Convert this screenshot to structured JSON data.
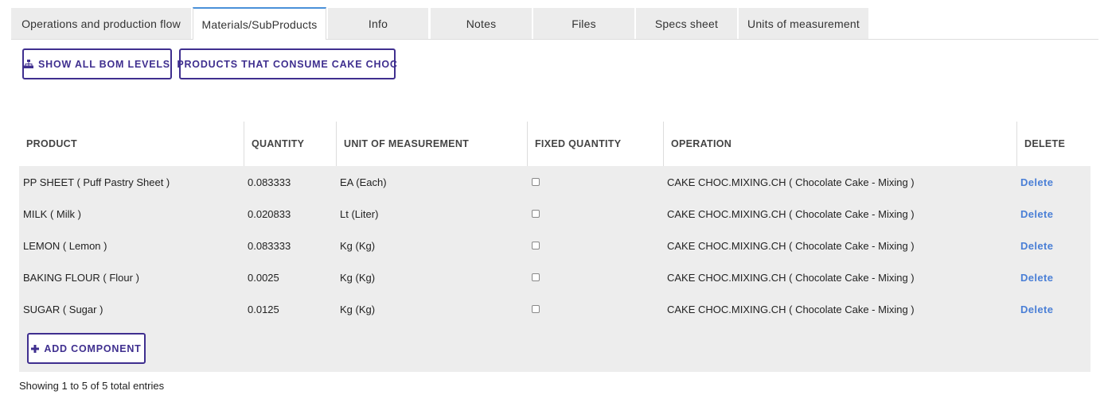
{
  "tabs": [
    {
      "label": "Operations and production flow"
    },
    {
      "label": "Materials/SubProducts"
    },
    {
      "label": "Info"
    },
    {
      "label": "Notes"
    },
    {
      "label": "Files"
    },
    {
      "label": "Specs sheet"
    },
    {
      "label": "Units of measurement"
    }
  ],
  "active_tab": "Materials/SubProducts",
  "actions": {
    "show_bom_label": "SHOW ALL BOM LEVELS",
    "consumers_label": "PRODUCTS THAT CONSUME CAKE CHOC",
    "add_component_label": "ADD COMPONENT"
  },
  "icons": {
    "bom": "sitemap-icon",
    "add": "plus-icon"
  },
  "colors": {
    "accent": "#3f2f8f",
    "active_tab_border": "#4a90d9",
    "delete_link": "#4a7fd6",
    "table_bg": "#ededed"
  },
  "table": {
    "columns": [
      "PRODUCT",
      "QUANTITY",
      "UNIT OF MEASUREMENT",
      "FIXED QUANTITY",
      "OPERATION",
      "DELETE"
    ],
    "rows": [
      {
        "product": "PP SHEET ( Puff Pastry Sheet )",
        "quantity": "0.083333",
        "uom": "EA (Each)",
        "fixed": false,
        "operation": "CAKE CHOC.MIXING.CH ( Chocolate Cake - Mixing )",
        "delete": "Delete"
      },
      {
        "product": "MILK ( Milk )",
        "quantity": "0.020833",
        "uom": "Lt (Liter)",
        "fixed": false,
        "operation": "CAKE CHOC.MIXING.CH ( Chocolate Cake - Mixing )",
        "delete": "Delete"
      },
      {
        "product": "LEMON ( Lemon )",
        "quantity": "0.083333",
        "uom": "Kg (Kg)",
        "fixed": false,
        "operation": "CAKE CHOC.MIXING.CH ( Chocolate Cake - Mixing )",
        "delete": "Delete"
      },
      {
        "product": "BAKING FLOUR ( Flour )",
        "quantity": "0.0025",
        "uom": "Kg (Kg)",
        "fixed": false,
        "operation": "CAKE CHOC.MIXING.CH ( Chocolate Cake - Mixing )",
        "delete": "Delete"
      },
      {
        "product": "SUGAR ( Sugar )",
        "quantity": "0.0125",
        "uom": "Kg (Kg)",
        "fixed": false,
        "operation": "CAKE CHOC.MIXING.CH ( Chocolate Cake - Mixing )",
        "delete": "Delete"
      }
    ]
  },
  "footer": {
    "entries_text": "Showing 1 to 5 of 5 total entries"
  }
}
